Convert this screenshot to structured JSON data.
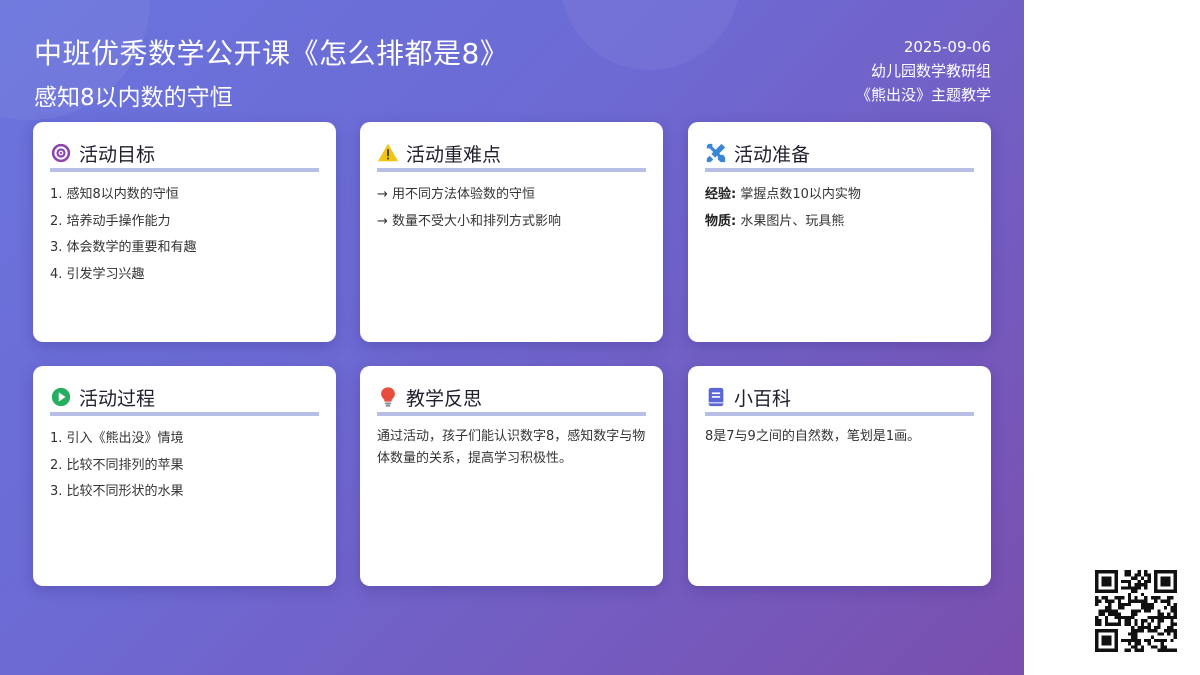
{
  "header": {
    "title": "中班优秀数学公开课《怎么排都是8》",
    "subtitle": "感知8以内数的守恒",
    "date": "2025-09-06",
    "org": "幼儿园数学教研组",
    "theme": "《熊出没》主题教学"
  },
  "cards": {
    "goals": {
      "title": "活动目标",
      "icon": "target-icon",
      "items": [
        "1. 感知8以内数的守恒",
        "2. 培养动手操作能力",
        "3. 体会数学的重要和有趣",
        "4. 引发学习兴趣"
      ]
    },
    "key_points": {
      "title": "活动重难点",
      "icon": "warning-icon",
      "items": [
        "→ 用不同方法体验数的守恒",
        "→ 数量不受大小和排列方式影响"
      ]
    },
    "preparation": {
      "title": "活动准备",
      "icon": "tools-icon",
      "items": [
        {
          "label": "经验:",
          "value": "掌握点数10以内实物"
        },
        {
          "label": "物质:",
          "value": "水果图片、玩具熊"
        }
      ]
    },
    "process": {
      "title": "活动过程",
      "icon": "play-icon",
      "items": [
        "1. 引入《熊出没》情境",
        "2. 比较不同排列的苹果",
        "3. 比较不同形状的水果"
      ]
    },
    "reflection": {
      "title": "教学反思",
      "icon": "lightbulb-icon",
      "text": "通过活动，孩子们能认识数字8，感知数字与物体数量的关系，提高学习积极性。"
    },
    "encyclopedia": {
      "title": "小百科",
      "icon": "book-icon",
      "text": "8是7与9之间的自然数，笔划是1画。"
    }
  },
  "colors": {
    "gradient_start": "#6a74dd",
    "gradient_end": "#7a4fae",
    "card_underline": "#b8bfe6",
    "target": "#8e44ad",
    "warning": "#f1c40f",
    "tools": "#3a86d6",
    "play": "#27ae60",
    "lightbulb": "#e74c3c",
    "book": "#5b67d6"
  }
}
